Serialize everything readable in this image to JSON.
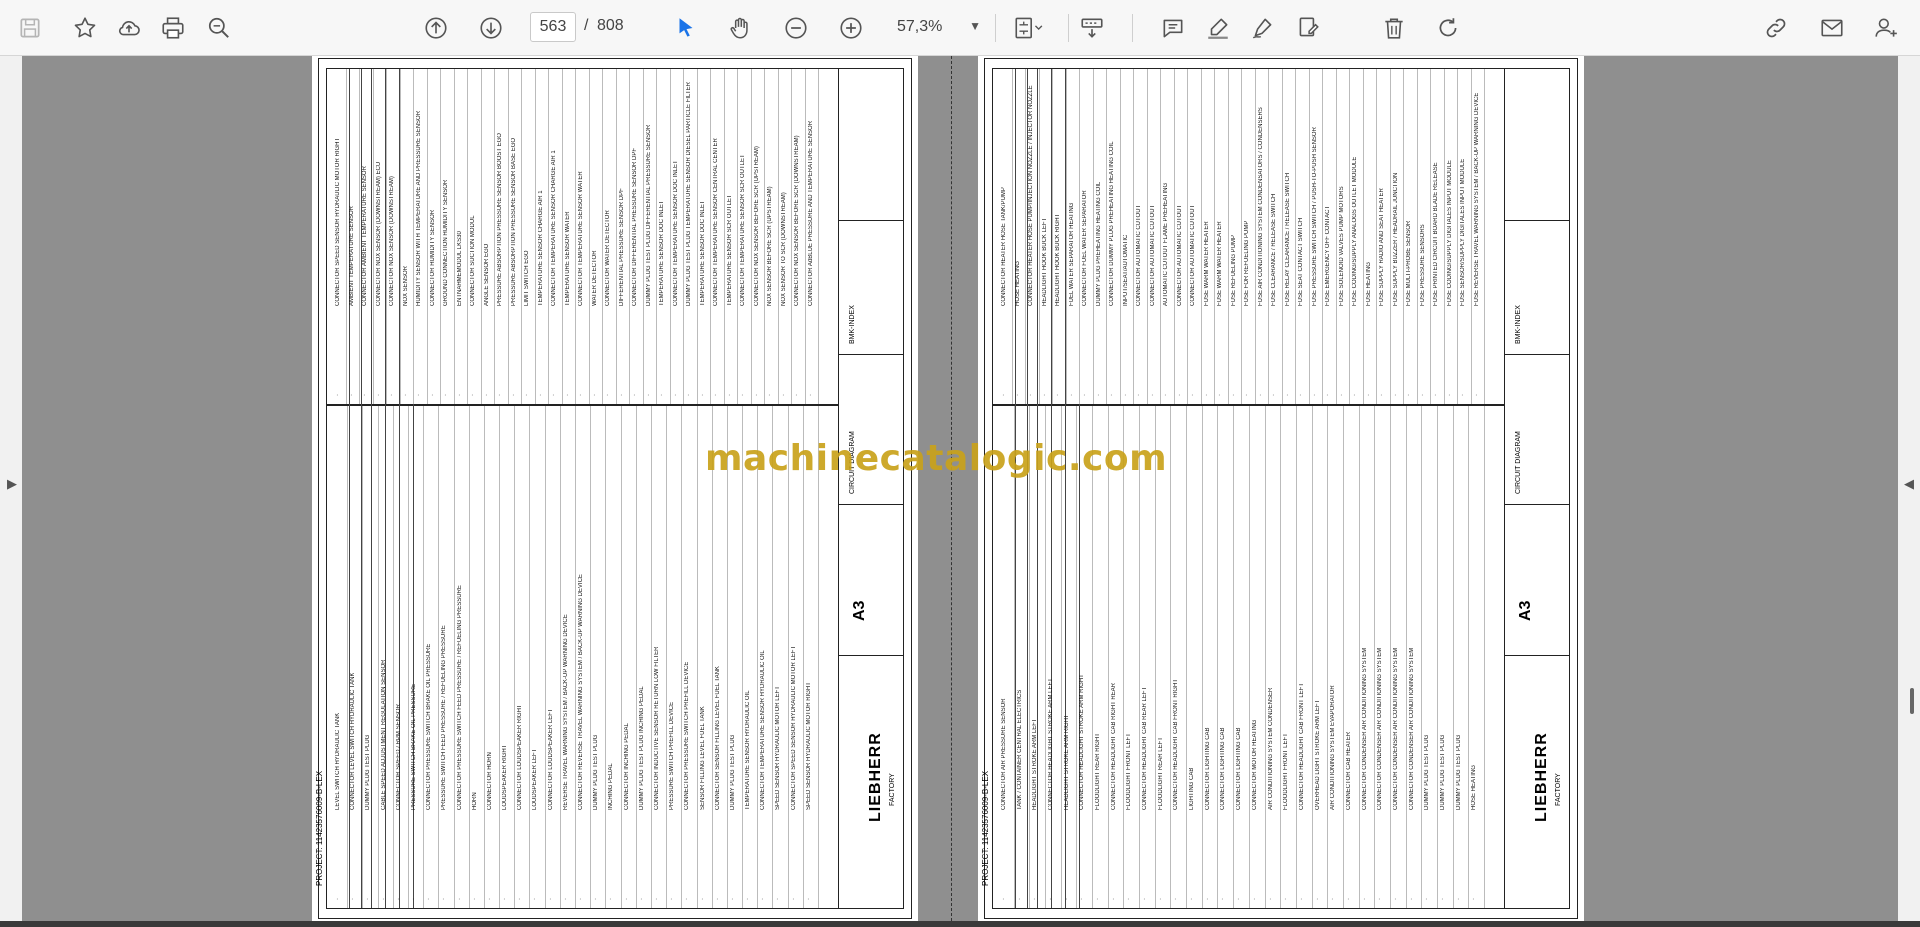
{
  "toolbar": {
    "current_page": "563",
    "page_separator": "/",
    "total_pages": "808",
    "zoom": "57,3%"
  },
  "icons": {
    "save": "save-icon",
    "bookmark": "star-icon",
    "upload": "upload-icon",
    "print": "print-icon",
    "search": "zoom-search-icon",
    "prev": "arrow-up-circle-icon",
    "next": "arrow-down-circle-icon",
    "select": "cursor-icon",
    "hand": "hand-icon",
    "zoom_out": "minus-circle-icon",
    "zoom_in": "plus-circle-icon",
    "fit": "fit-page-icon",
    "scroll_mode": "scroll-mode-icon",
    "comment": "comment-icon",
    "highlight": "pen-highlight-icon",
    "draw": "draw-icon",
    "sign": "sign-icon",
    "delete": "trash-icon",
    "rotate": "rotate-icon",
    "share_link": "link-icon",
    "email": "mail-icon",
    "account": "account-icon"
  },
  "colors": {
    "accent": "#1a73e8",
    "watermark": "#c9a21b"
  },
  "watermark": "machinecatalogic.com",
  "page_left": {
    "logo": "LIEBHERR",
    "format": "A3",
    "factory": "FACTORY",
    "designation": "CIRCUIT DIAGRAM",
    "project": "PROJECT: 11423576009-B-LEX",
    "description": "BMK-INDEX",
    "upper_items": [
      "CONNECTOR SPEED SENSOR HYDRAULIC MOTOR RIGHT",
      "AMBIENT TEMPERATURE SENSOR",
      "CONNECTOR AMBIENT TEMPERATURE SENSOR",
      "CONNECTOR NOX SENSOR (DOWNSTREAM) ECU",
      "CONNECTOR NOX SENSOR (DOWNSTREAM)",
      "NOX SENSOR",
      "HUMIDITY SENSOR WITH TEMPERATURE AND PRESSURE SENSOR",
      "CONNECTOR HUMIDITY SENSOR",
      "GROUND CONNECTION HUMIDITY SENSOR",
      "ENTNAHMEMODUL LKS30",
      "CONNECTOR SUCTION MODUL",
      "ANGLE SENSOR EGO",
      "PRESSURE ABSORPTION PRESSURE SENSOR BOOST EGO",
      "PRESSURE ABSORPTION PRESSURE SENSOR BASE EGO",
      "LIMIT SWITCH EGO",
      "TEMPERATURE SENSOR CHARGE AIR 1",
      "CONNECTOR TEMPERATURE SENSOR CHARGE AIR 1",
      "TEMPERATURE SENSOR WATER",
      "CONNECTOR TEMPERATURE SENSOR WATER",
      "WATER DETECTOR",
      "CONNECTOR WATER DETECTOR",
      "DIFFERENTIAL PRESSURE SENSOR DPF",
      "CONNECTOR DIFFERENTIAL PRESSURE SENSOR DPF",
      "DUMMY PLUG TEST PLUG DIFFERENTIAL PRESSURE SENSOR",
      "TEMPERATURE SENSOR DOC INLET",
      "CONNECTOR TEMPERATURE SENSOR DOC INLET",
      "DUMMY PLUG TEST PLUG TEMPERATURE SENSOR DIESEL PARTICLE FILTER",
      "TEMPERATURE SENSOR DOC INLET",
      "CONNECTOR TEMPERATURE SENSOR CENTRAL CENTER",
      "TEMPERATURE SENSOR SCR OUTLET",
      "CONNECTOR TEMPERATURE SENSOR SCR OUTLET",
      "CONNECTOR NOX SENSOR BEFORE SCR (UPSTREAM)",
      "NOX SENSOR BEFORE SCR (UPSTREAM)",
      "NOX SENSOR TO SCR (DOWNSTREAM)",
      "CONNECTOR NOX SENSOR BEFORE SCR (DOWNSTREAM)",
      "CONNECTOR AdBLUE PRESSURE AND TEMPERATURE SENSOR"
    ],
    "lower_items": [
      "LEVEL SWITCH HYDRAULIC TANK",
      "CONNECTOR LEVEL SWITCH HYDRAULIC TANK",
      "DUMMY PLUG TEST PLUG",
      "CABLE SPEED ADJUSTMENT REGULATION SENSOR",
      "CONNECTOR SPEED / RPM SENSOR",
      "PRESSURE SWITCH BRAKE OIL PRESSURE",
      "CONNECTOR PRESSURE SWITCH BRAKE OIL PRESSURE",
      "PRESSURE SWITCH FEED PRESSURE / REFUELING PRESSURE",
      "CONNECTOR PRESSURE SWITCH FEED PRESSURE / REFUELING PRESSURE",
      "HORN",
      "CONNECTOR HORN",
      "LOUDSPEAKER RIGHT",
      "CONNECTOR LOUDSPEAKER RIGHT",
      "LOUDSPEAKER LEFT",
      "CONNECTOR LOUDSPEAKER LEFT",
      "REVERSE TRAVEL WARNING SYSTEM / BACK-UP WARNING DEVICE",
      "CONNECTOR REVERSE TRAVEL WARNING SYSTEM / BACK-UP WARNING DEVICE",
      "DUMMY PLUG TEST PLUG",
      "INCHING PEDAL",
      "CONNECTOR INCHING PEDAL",
      "DUMMY PLUG TEST PLUG INCHING PEDAL",
      "CONNECTOR INDUCTIVE SENSOR RETURN LOW FILTER",
      "PRESSURE SWITCH PREFILL DEVICE",
      "CONNECTOR PRESSURE SWITCH PREFILL DEVICE",
      "SENSOR FILLING LEVEL FUEL TANK",
      "CONNECTOR SENSOR FILLING LEVEL FUEL TANK",
      "DUMMY PLUG TEST PLUG",
      "TEMPERATURE SENSOR HYDRAULIC OIL",
      "CONNECTOR TEMPERATURE SENSOR HYDRAULIC OIL",
      "SPEED SENSOR HYDRAULIC MOTOR LEFT",
      "CONNECTOR SPEED SENSOR HYDRAULIC MOTOR LEFT",
      "SPEED SENSOR HYDRAULIC MOTOR RIGHT"
    ]
  },
  "page_right": {
    "logo": "LIEBHERR",
    "format": "A3",
    "factory": "FACTORY",
    "designation": "CIRCUIT DIAGRAM",
    "project": "PROJECT: 11423576009-B-LEX",
    "description": "BMK-INDEX",
    "upper_items": [
      "CONNECTOR HEATER HOSE TANK/PUMP",
      "HOSE HEATING",
      "CONNECTOR HEATER HOSE PUMP/INJECTION NOZZLE / INJECTOR NOZZLE",
      "HEADLIGHT HOOK BUCK LEFT",
      "HEADLIGHT HOOK BUCK RIGHT",
      "FUEL WATER SEPARATOR HEATING",
      "CONNECTOR FUEL WATER SEPARATOR",
      "DUMMY PLUG PREHEATING HEATING COIL",
      "CONNECTOR DUMMY PLUG PREHEATING HEATING COIL",
      "INPUT/SEAT/AUTOMATIC",
      "CONNECTOR AUTOMATIC CUTOUT",
      "CONNECTOR AUTOMATIC CUTOUT",
      "AUTOMATIC CUTOUT FLAME PREHEATING",
      "CONNECTOR AUTOMATIC CUTOUT",
      "CONNECTOR AUTOMATIC CUTOUT",
      "FUSE WARM WATER HEATER",
      "FUSE WARM WATER HEATER",
      "FUSE REFUELING PUMP",
      "FUSE FOR REFUELING PUMP",
      "FUSE AIR CONDITIONING SYSTEM CONDENSATORS / CONDENSERS",
      "FUSE CLEARANCE / RELEASE SWITCH",
      "FUSE RELAY CLEARANCE / RELEASE SWITCH",
      "FUSE SEAT CONTACT SWITCH",
      "FUSE PRESSURE SWITCH SWITCH / PUSH-TO-PUSH SENSOR",
      "FUSE EMERGENCY OFF CONTACT",
      "FUSE SOLENOID VALVES PUMP MOTORS",
      "FUSE CODING/SUPPLY ANALOGS OUTLET MODULE",
      "FUSE HEATING",
      "FUSE SUPPLY RADIO AND SEAT HEATER",
      "FUSE SUPPLY BUZZER / HEADRAIL JUNCTION",
      "FUSE MULTI-PROBE SENSOR",
      "FUSE PRESSURE SENSORS",
      "FUSE PRINTED CIRCUIT BOARD BLADE RELEASE",
      "FUSE CODING/SUPPLY DIGITALES INPUT MODULE",
      "FUSE SENSOR/SUPPLY DIGITALES INPUT MODULE",
      "FUSE REVERSE TRAVEL WARNING SYSTEM / BACK-UP WARNING DEVICE"
    ],
    "lower_items": [
      "CONNECTOR AIR PRESSURE SENSOR",
      "TANK / CONTAINER CENTRAL ELECTRICS",
      "HEADLIGHT STROKE ARM LEFT",
      "CONNECTOR HEADLIGHT STROKE ARM LEFT",
      "HEADLIGHT STROKE ARM RIGHT",
      "CONNECTOR HEADLIGHT STROKE ARM RIGHT",
      "FLOODLIGHT REAR RIGHT",
      "CONNECTOR HEADLIGHT CAB RIGHT REAR",
      "FLOODLIGHT FRONT LEFT",
      "CONNECTOR HEADLIGHT CAB REAR LEFT",
      "FLOODLIGHT REAR LEFT",
      "CONNECTOR HEADLIGHT CAB FRONT RIGHT",
      "LIGHTING CAB",
      "CONNECTOR LIGHTING CAB",
      "CONNECTOR LIGHTING CAB",
      "CONNECTOR LIGHTING CAB",
      "CONNECTOR MOTOR HEATING",
      "AIR CONDITIONING SYSTEM CONDENSER",
      "FLOODLIGHT FRONT LEFT",
      "CONNECTOR HEADLIGHT CAB FRONT LEFT",
      "OVERHEAD LIGHT STROKE ARM LEFT",
      "AIR CONDITIONING SYSTEM EVAPORATOR",
      "CONNECTOR CAB HEATER",
      "CONNECTOR CONDENSER AIR CONDITIONING SYSTEM",
      "CONNECTOR CONDENSER AIR CONDITIONING SYSTEM",
      "CONNECTOR CONDENSER AIR CONDITIONING SYSTEM",
      "CONNECTOR CONDENSER AIR CONDITIONING SYSTEM",
      "DUMMY PLUG TEST PLUG",
      "DUMMY PLUG TEST PLUG",
      "DUMMY PLUG TEST PLUG",
      "HOSE HEATING"
    ]
  }
}
